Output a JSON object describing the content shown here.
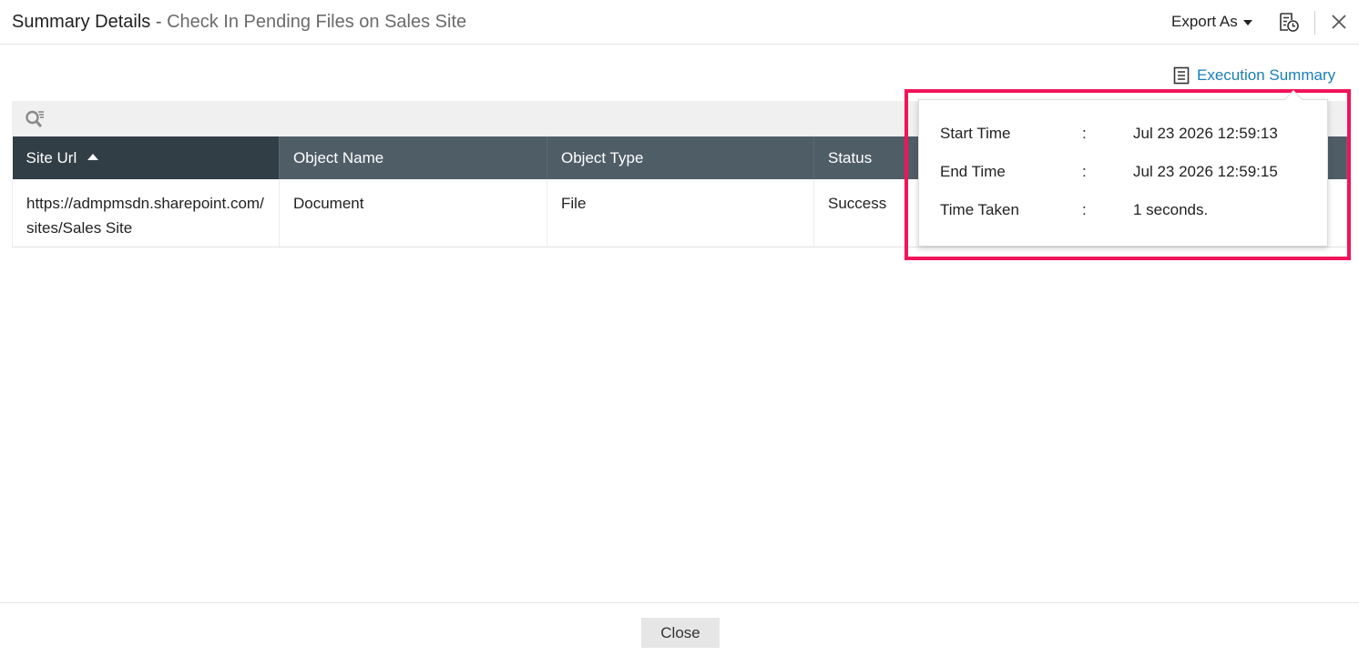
{
  "header": {
    "title": "Summary Details",
    "separator": "-",
    "subtitle": "Check In Pending Files on Sales Site",
    "export_label": "Export As",
    "icons": {
      "schedule": "schedule-report-icon",
      "close": "close-icon",
      "caret": "caret-down-icon"
    }
  },
  "execution_summary": {
    "link_label": "Execution Summary",
    "icon": "document-list-icon",
    "rows": [
      {
        "label": "Start Time",
        "colon": ":",
        "value": "Jul 23 2026 12:59:13"
      },
      {
        "label": "End Time",
        "colon": ":",
        "value": "Jul 23 2026 12:59:15"
      },
      {
        "label": "Time Taken",
        "colon": ":",
        "value": "1 seconds."
      }
    ],
    "highlight_color": "#f0145a"
  },
  "toolbar": {
    "search_icon": "search-filter-icon"
  },
  "table": {
    "columns": [
      "Site Url",
      "Object Name",
      "Object Type",
      "Status"
    ],
    "sorted_column": "Site Url",
    "sort_direction": "ascending",
    "rows": [
      {
        "site_url": "https://admpmsdn.sharepoint.com/sites/Sales Site",
        "object_name": "Document",
        "object_type": "File",
        "status": "Success"
      }
    ]
  },
  "footer": {
    "close_label": "Close"
  },
  "colors": {
    "link": "#1a7fb5",
    "header_bg": "#4f5d67",
    "sorted_header_bg": "#323e46"
  }
}
